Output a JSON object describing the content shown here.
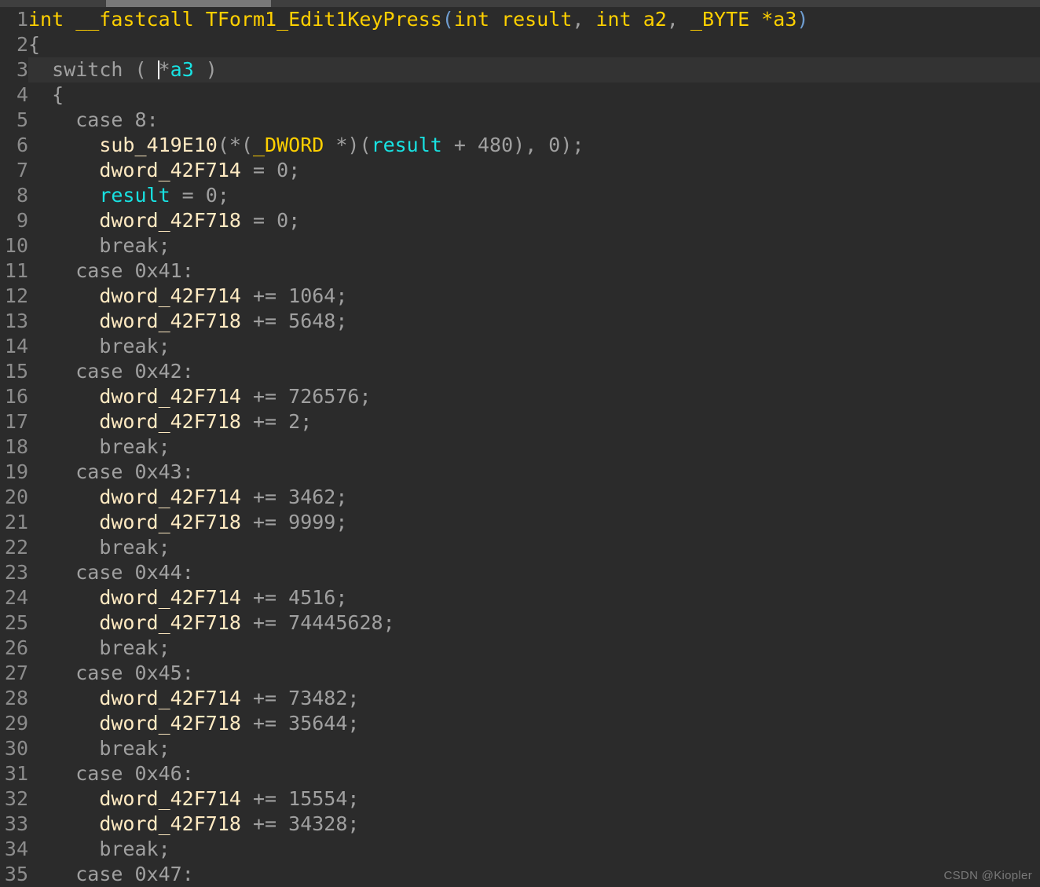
{
  "editor": {
    "background_color": "#2b2b2b",
    "highlight_line_color": "#333333",
    "gutter_color": "#8c8c8c",
    "current_line": 3,
    "caret_line": 3,
    "first_line_number": 1,
    "last_line_number": 35
  },
  "scrollbar": {
    "orientation": "horizontal",
    "track_color": "#3f3f3f",
    "thumb_color": "#787878"
  },
  "colors": {
    "function": "#ffd000",
    "identifier": "#ffeac2",
    "variable": "#18e2e2",
    "punctuation": "#a0a0a0",
    "keyword": "#a0a0a0",
    "number": "#a0a0a0",
    "type": "#ffd000",
    "paren_declaration": "#6f9dd0"
  },
  "watermark": {
    "text": "CSDN @Kiopler"
  },
  "lines": [
    {
      "n": "1",
      "tokens": [
        {
          "t": "int __fastcall TForm1_Edit1KeyPress",
          "c": "t-fn"
        },
        {
          "t": "(",
          "c": "t-paren"
        },
        {
          "t": "int result",
          "c": "t-fn"
        },
        {
          "t": ",",
          "c": "t-punct"
        },
        {
          "t": " int a2",
          "c": "t-fn"
        },
        {
          "t": ",",
          "c": "t-punct"
        },
        {
          "t": " _BYTE *a3",
          "c": "t-fn"
        },
        {
          "t": ")",
          "c": "t-paren"
        }
      ]
    },
    {
      "n": "2",
      "tokens": [
        {
          "t": "{",
          "c": "t-punct"
        }
      ]
    },
    {
      "n": "3",
      "hl": true,
      "tokens": [
        {
          "t": "  ",
          "c": "t-punct"
        },
        {
          "t": "switch",
          "c": "t-kw"
        },
        {
          "t": " ( ",
          "c": "t-punct"
        },
        {
          "t": "CARET",
          "c": "caret"
        },
        {
          "t": "*",
          "c": "t-punct"
        },
        {
          "t": "a3",
          "c": "t-var"
        },
        {
          "t": " )",
          "c": "t-punct"
        }
      ]
    },
    {
      "n": "4",
      "tokens": [
        {
          "t": "  {",
          "c": "t-punct"
        }
      ]
    },
    {
      "n": "5",
      "tokens": [
        {
          "t": "    ",
          "c": "t-punct"
        },
        {
          "t": "case",
          "c": "t-kw"
        },
        {
          "t": " ",
          "c": "t-punct"
        },
        {
          "t": "8",
          "c": "t-num"
        },
        {
          "t": ":",
          "c": "t-punct"
        }
      ]
    },
    {
      "n": "6",
      "tokens": [
        {
          "t": "      ",
          "c": "t-punct"
        },
        {
          "t": "sub_419E10",
          "c": "t-ident"
        },
        {
          "t": "(*(",
          "c": "t-punct"
        },
        {
          "t": "_DWORD",
          "c": "t-type"
        },
        {
          "t": " *)(",
          "c": "t-punct"
        },
        {
          "t": "result",
          "c": "t-var"
        },
        {
          "t": " + ",
          "c": "t-punct"
        },
        {
          "t": "480",
          "c": "t-num"
        },
        {
          "t": "), ",
          "c": "t-punct"
        },
        {
          "t": "0",
          "c": "t-num"
        },
        {
          "t": ");",
          "c": "t-punct"
        }
      ]
    },
    {
      "n": "7",
      "tokens": [
        {
          "t": "      ",
          "c": "t-punct"
        },
        {
          "t": "dword_42F714",
          "c": "t-ident"
        },
        {
          "t": " = ",
          "c": "t-punct"
        },
        {
          "t": "0",
          "c": "t-num"
        },
        {
          "t": ";",
          "c": "t-punct"
        }
      ]
    },
    {
      "n": "8",
      "tokens": [
        {
          "t": "      ",
          "c": "t-punct"
        },
        {
          "t": "result",
          "c": "t-var"
        },
        {
          "t": " = ",
          "c": "t-punct"
        },
        {
          "t": "0",
          "c": "t-num"
        },
        {
          "t": ";",
          "c": "t-punct"
        }
      ]
    },
    {
      "n": "9",
      "tokens": [
        {
          "t": "      ",
          "c": "t-punct"
        },
        {
          "t": "dword_42F718",
          "c": "t-ident"
        },
        {
          "t": " = ",
          "c": "t-punct"
        },
        {
          "t": "0",
          "c": "t-num"
        },
        {
          "t": ";",
          "c": "t-punct"
        }
      ]
    },
    {
      "n": "10",
      "tokens": [
        {
          "t": "      ",
          "c": "t-punct"
        },
        {
          "t": "break",
          "c": "t-kw"
        },
        {
          "t": ";",
          "c": "t-punct"
        }
      ]
    },
    {
      "n": "11",
      "tokens": [
        {
          "t": "    ",
          "c": "t-punct"
        },
        {
          "t": "case",
          "c": "t-kw"
        },
        {
          "t": " ",
          "c": "t-punct"
        },
        {
          "t": "0x41",
          "c": "t-num"
        },
        {
          "t": ":",
          "c": "t-punct"
        }
      ]
    },
    {
      "n": "12",
      "tokens": [
        {
          "t": "      ",
          "c": "t-punct"
        },
        {
          "t": "dword_42F714",
          "c": "t-ident"
        },
        {
          "t": " += ",
          "c": "t-punct"
        },
        {
          "t": "1064",
          "c": "t-num"
        },
        {
          "t": ";",
          "c": "t-punct"
        }
      ]
    },
    {
      "n": "13",
      "tokens": [
        {
          "t": "      ",
          "c": "t-punct"
        },
        {
          "t": "dword_42F718",
          "c": "t-ident"
        },
        {
          "t": " += ",
          "c": "t-punct"
        },
        {
          "t": "5648",
          "c": "t-num"
        },
        {
          "t": ";",
          "c": "t-punct"
        }
      ]
    },
    {
      "n": "14",
      "tokens": [
        {
          "t": "      ",
          "c": "t-punct"
        },
        {
          "t": "break",
          "c": "t-kw"
        },
        {
          "t": ";",
          "c": "t-punct"
        }
      ]
    },
    {
      "n": "15",
      "tokens": [
        {
          "t": "    ",
          "c": "t-punct"
        },
        {
          "t": "case",
          "c": "t-kw"
        },
        {
          "t": " ",
          "c": "t-punct"
        },
        {
          "t": "0x42",
          "c": "t-num"
        },
        {
          "t": ":",
          "c": "t-punct"
        }
      ]
    },
    {
      "n": "16",
      "tokens": [
        {
          "t": "      ",
          "c": "t-punct"
        },
        {
          "t": "dword_42F714",
          "c": "t-ident"
        },
        {
          "t": " += ",
          "c": "t-punct"
        },
        {
          "t": "726576",
          "c": "t-num"
        },
        {
          "t": ";",
          "c": "t-punct"
        }
      ]
    },
    {
      "n": "17",
      "tokens": [
        {
          "t": "      ",
          "c": "t-punct"
        },
        {
          "t": "dword_42F718",
          "c": "t-ident"
        },
        {
          "t": " += ",
          "c": "t-punct"
        },
        {
          "t": "2",
          "c": "t-num"
        },
        {
          "t": ";",
          "c": "t-punct"
        }
      ]
    },
    {
      "n": "18",
      "tokens": [
        {
          "t": "      ",
          "c": "t-punct"
        },
        {
          "t": "break",
          "c": "t-kw"
        },
        {
          "t": ";",
          "c": "t-punct"
        }
      ]
    },
    {
      "n": "19",
      "tokens": [
        {
          "t": "    ",
          "c": "t-punct"
        },
        {
          "t": "case",
          "c": "t-kw"
        },
        {
          "t": " ",
          "c": "t-punct"
        },
        {
          "t": "0x43",
          "c": "t-num"
        },
        {
          "t": ":",
          "c": "t-punct"
        }
      ]
    },
    {
      "n": "20",
      "tokens": [
        {
          "t": "      ",
          "c": "t-punct"
        },
        {
          "t": "dword_42F714",
          "c": "t-ident"
        },
        {
          "t": " += ",
          "c": "t-punct"
        },
        {
          "t": "3462",
          "c": "t-num"
        },
        {
          "t": ";",
          "c": "t-punct"
        }
      ]
    },
    {
      "n": "21",
      "tokens": [
        {
          "t": "      ",
          "c": "t-punct"
        },
        {
          "t": "dword_42F718",
          "c": "t-ident"
        },
        {
          "t": " += ",
          "c": "t-punct"
        },
        {
          "t": "9999",
          "c": "t-num"
        },
        {
          "t": ";",
          "c": "t-punct"
        }
      ]
    },
    {
      "n": "22",
      "tokens": [
        {
          "t": "      ",
          "c": "t-punct"
        },
        {
          "t": "break",
          "c": "t-kw"
        },
        {
          "t": ";",
          "c": "t-punct"
        }
      ]
    },
    {
      "n": "23",
      "tokens": [
        {
          "t": "    ",
          "c": "t-punct"
        },
        {
          "t": "case",
          "c": "t-kw"
        },
        {
          "t": " ",
          "c": "t-punct"
        },
        {
          "t": "0x44",
          "c": "t-num"
        },
        {
          "t": ":",
          "c": "t-punct"
        }
      ]
    },
    {
      "n": "24",
      "tokens": [
        {
          "t": "      ",
          "c": "t-punct"
        },
        {
          "t": "dword_42F714",
          "c": "t-ident"
        },
        {
          "t": " += ",
          "c": "t-punct"
        },
        {
          "t": "4516",
          "c": "t-num"
        },
        {
          "t": ";",
          "c": "t-punct"
        }
      ]
    },
    {
      "n": "25",
      "tokens": [
        {
          "t": "      ",
          "c": "t-punct"
        },
        {
          "t": "dword_42F718",
          "c": "t-ident"
        },
        {
          "t": " += ",
          "c": "t-punct"
        },
        {
          "t": "74445628",
          "c": "t-num"
        },
        {
          "t": ";",
          "c": "t-punct"
        }
      ]
    },
    {
      "n": "26",
      "tokens": [
        {
          "t": "      ",
          "c": "t-punct"
        },
        {
          "t": "break",
          "c": "t-kw"
        },
        {
          "t": ";",
          "c": "t-punct"
        }
      ]
    },
    {
      "n": "27",
      "tokens": [
        {
          "t": "    ",
          "c": "t-punct"
        },
        {
          "t": "case",
          "c": "t-kw"
        },
        {
          "t": " ",
          "c": "t-punct"
        },
        {
          "t": "0x45",
          "c": "t-num"
        },
        {
          "t": ":",
          "c": "t-punct"
        }
      ]
    },
    {
      "n": "28",
      "tokens": [
        {
          "t": "      ",
          "c": "t-punct"
        },
        {
          "t": "dword_42F714",
          "c": "t-ident"
        },
        {
          "t": " += ",
          "c": "t-punct"
        },
        {
          "t": "73482",
          "c": "t-num"
        },
        {
          "t": ";",
          "c": "t-punct"
        }
      ]
    },
    {
      "n": "29",
      "tokens": [
        {
          "t": "      ",
          "c": "t-punct"
        },
        {
          "t": "dword_42F718",
          "c": "t-ident"
        },
        {
          "t": " += ",
          "c": "t-punct"
        },
        {
          "t": "35644",
          "c": "t-num"
        },
        {
          "t": ";",
          "c": "t-punct"
        }
      ]
    },
    {
      "n": "30",
      "tokens": [
        {
          "t": "      ",
          "c": "t-punct"
        },
        {
          "t": "break",
          "c": "t-kw"
        },
        {
          "t": ";",
          "c": "t-punct"
        }
      ]
    },
    {
      "n": "31",
      "tokens": [
        {
          "t": "    ",
          "c": "t-punct"
        },
        {
          "t": "case",
          "c": "t-kw"
        },
        {
          "t": " ",
          "c": "t-punct"
        },
        {
          "t": "0x46",
          "c": "t-num"
        },
        {
          "t": ":",
          "c": "t-punct"
        }
      ]
    },
    {
      "n": "32",
      "tokens": [
        {
          "t": "      ",
          "c": "t-punct"
        },
        {
          "t": "dword_42F714",
          "c": "t-ident"
        },
        {
          "t": " += ",
          "c": "t-punct"
        },
        {
          "t": "15554",
          "c": "t-num"
        },
        {
          "t": ";",
          "c": "t-punct"
        }
      ]
    },
    {
      "n": "33",
      "tokens": [
        {
          "t": "      ",
          "c": "t-punct"
        },
        {
          "t": "dword_42F718",
          "c": "t-ident"
        },
        {
          "t": " += ",
          "c": "t-punct"
        },
        {
          "t": "34328",
          "c": "t-num"
        },
        {
          "t": ";",
          "c": "t-punct"
        }
      ]
    },
    {
      "n": "34",
      "tokens": [
        {
          "t": "      ",
          "c": "t-punct"
        },
        {
          "t": "break",
          "c": "t-kw"
        },
        {
          "t": ";",
          "c": "t-punct"
        }
      ]
    },
    {
      "n": "35",
      "tokens": [
        {
          "t": "    ",
          "c": "t-punct"
        },
        {
          "t": "case",
          "c": "t-kw"
        },
        {
          "t": " ",
          "c": "t-punct"
        },
        {
          "t": "0x47",
          "c": "t-num"
        },
        {
          "t": ":",
          "c": "t-punct"
        }
      ]
    }
  ]
}
